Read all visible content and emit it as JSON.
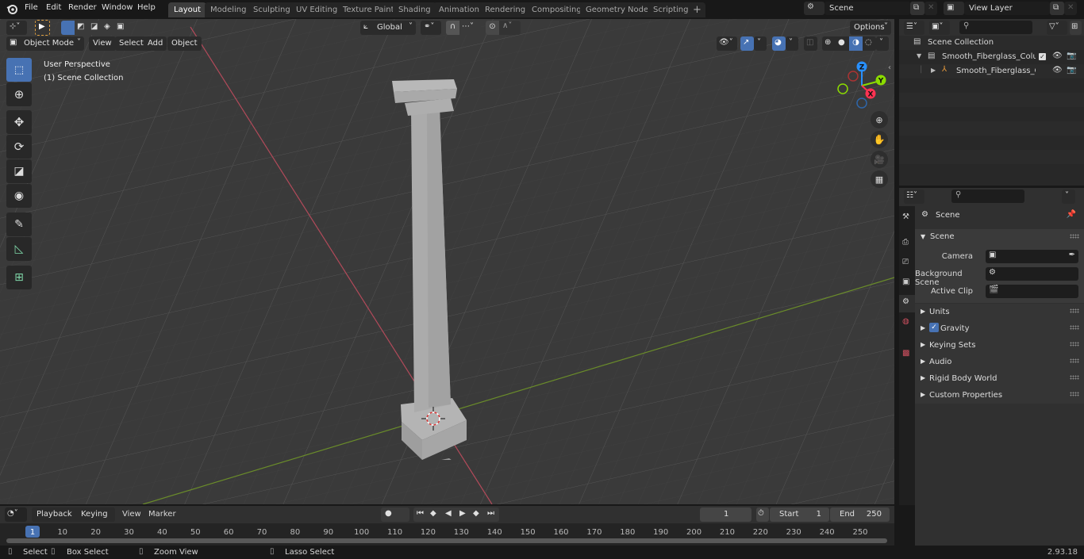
{
  "menu": {
    "items": [
      "File",
      "Edit",
      "Render",
      "Window",
      "Help"
    ]
  },
  "workspaces": [
    "Layout",
    "Modeling",
    "Sculpting",
    "UV Editing",
    "Texture Paint",
    "Shading",
    "Animation",
    "Rendering",
    "Compositing",
    "Geometry Nodes",
    "Scripting"
  ],
  "active_workspace": "Layout",
  "scene_selector": {
    "value": "Scene"
  },
  "view_layer_selector": {
    "value": "View Layer"
  },
  "viewport_header": {
    "mode": "Object Mode",
    "menus": [
      "View",
      "Select",
      "Add",
      "Object"
    ],
    "transform_orientation": "Global",
    "options_label": "Options"
  },
  "viewport": {
    "perspective_label": "User Perspective",
    "collection_label": "(1) Scene Collection",
    "gizmo_axes": [
      "X",
      "Y",
      "Z"
    ]
  },
  "outliner": {
    "root": "Scene Collection",
    "items": [
      {
        "name": "Smooth_Fiberglass_Column_(",
        "type": "collection",
        "expanded": true,
        "checked": true
      },
      {
        "name": "Smooth_Fiberglass_Colu",
        "type": "object",
        "expanded": false
      }
    ]
  },
  "properties": {
    "context_title": "Scene",
    "section_title": "Scene",
    "fields": [
      {
        "label": "Camera",
        "value": ""
      },
      {
        "label": "Background Scene",
        "value": ""
      },
      {
        "label": "Active Clip",
        "value": ""
      }
    ],
    "panels": [
      {
        "label": "Units",
        "checkbox": false
      },
      {
        "label": "Gravity",
        "checkbox": true,
        "checked": true
      },
      {
        "label": "Keying Sets",
        "checkbox": false
      },
      {
        "label": "Audio",
        "checkbox": false
      },
      {
        "label": "Rigid Body World",
        "checkbox": false
      },
      {
        "label": "Custom Properties",
        "checkbox": false
      }
    ]
  },
  "timeline": {
    "menus": [
      "Playback",
      "Keying",
      "View",
      "Marker"
    ],
    "current_frame": "1",
    "start_label": "Start",
    "start": "1",
    "end_label": "End",
    "end": "250",
    "ticks": [
      "1",
      "10",
      "20",
      "30",
      "40",
      "50",
      "60",
      "70",
      "80",
      "90",
      "100",
      "110",
      "120",
      "130",
      "140",
      "150",
      "160",
      "170",
      "180",
      "190",
      "200",
      "210",
      "220",
      "230",
      "240",
      "250"
    ]
  },
  "statusbar": {
    "hints": [
      "Select",
      "Box Select",
      "Zoom View",
      "Lasso Select"
    ],
    "version": "2.93.18"
  },
  "colors": {
    "accent": "#4772b3",
    "x_axis": "#ff3352",
    "y_axis": "#8bdc00",
    "z_axis": "#2890ff"
  }
}
